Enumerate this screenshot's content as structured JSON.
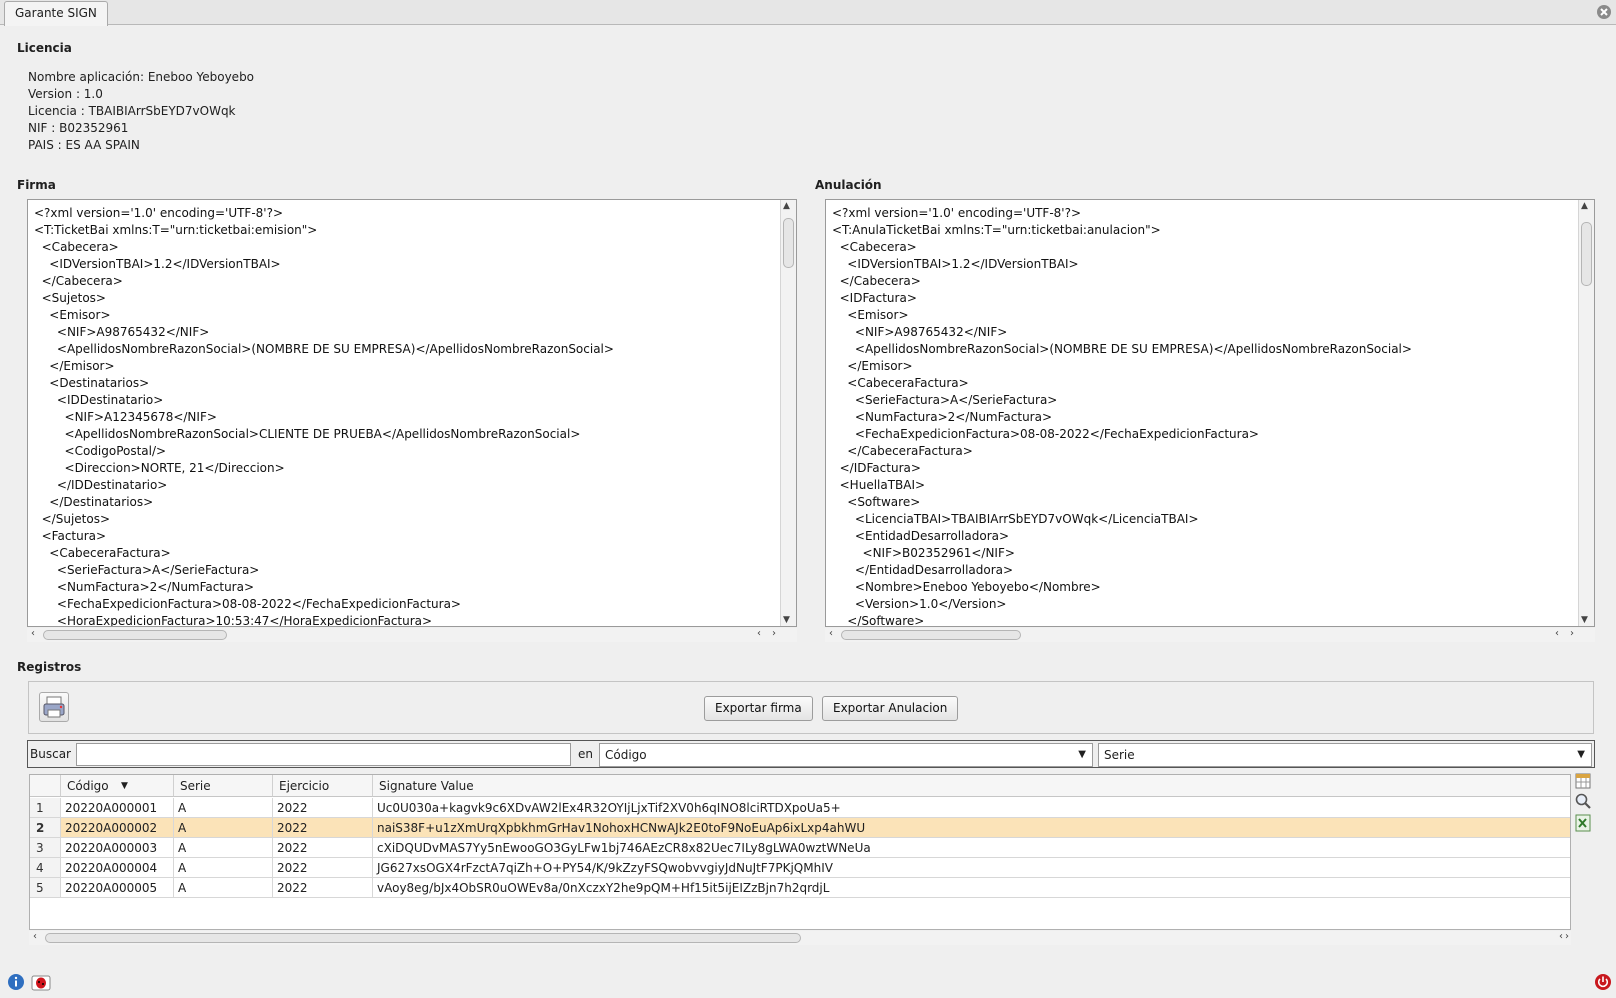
{
  "window": {
    "tab_title": "Garante SIGN"
  },
  "licencia": {
    "title": "Licencia",
    "lines": [
      "Nombre aplicación: Eneboo Yeboyebo",
      "Version : 1.0",
      "Licencia : TBAIBIArrSbEYD7vOWqk",
      "NIF : B02352961",
      "PAIS : ES AA SPAIN"
    ]
  },
  "firma": {
    "title": "Firma",
    "lines": [
      "<?xml version='1.0' encoding='UTF-8'?>",
      "<T:TicketBai xmlns:T=\"urn:ticketbai:emision\">",
      "  <Cabecera>",
      "    <IDVersionTBAI>1.2</IDVersionTBAI>",
      "  </Cabecera>",
      "  <Sujetos>",
      "    <Emisor>",
      "      <NIF>A98765432</NIF>",
      "      <ApellidosNombreRazonSocial>(NOMBRE DE SU EMPRESA)</ApellidosNombreRazonSocial>",
      "    </Emisor>",
      "    <Destinatarios>",
      "      <IDDestinatario>",
      "        <NIF>A12345678</NIF>",
      "        <ApellidosNombreRazonSocial>CLIENTE DE PRUEBA</ApellidosNombreRazonSocial>",
      "        <CodigoPostal/>",
      "        <Direccion>NORTE, 21</Direccion>",
      "      </IDDestinatario>",
      "    </Destinatarios>",
      "  </Sujetos>",
      "  <Factura>",
      "    <CabeceraFactura>",
      "      <SerieFactura>A</SerieFactura>",
      "      <NumFactura>2</NumFactura>",
      "      <FechaExpedicionFactura>08-08-2022</FechaExpedicionFactura>",
      "      <HoraExpedicionFactura>10:53:47</HoraExpedicionFactura>"
    ]
  },
  "anulacion": {
    "title": "Anulación",
    "lines": [
      "<?xml version='1.0' encoding='UTF-8'?>",
      "<T:AnulaTicketBai xmlns:T=\"urn:ticketbai:anulacion\">",
      "  <Cabecera>",
      "    <IDVersionTBAI>1.2</IDVersionTBAI>",
      "  </Cabecera>",
      "  <IDFactura>",
      "    <Emisor>",
      "      <NIF>A98765432</NIF>",
      "      <ApellidosNombreRazonSocial>(NOMBRE DE SU EMPRESA)</ApellidosNombreRazonSocial>",
      "    </Emisor>",
      "    <CabeceraFactura>",
      "      <SerieFactura>A</SerieFactura>",
      "      <NumFactura>2</NumFactura>",
      "      <FechaExpedicionFactura>08-08-2022</FechaExpedicionFactura>",
      "    </CabeceraFactura>",
      "  </IDFactura>",
      "  <HuellaTBAI>",
      "    <Software>",
      "      <LicenciaTBAI>TBAIBIArrSbEYD7vOWqk</LicenciaTBAI>",
      "      <EntidadDesarrolladora>",
      "        <NIF>B02352961</NIF>",
      "      </EntidadDesarrolladora>",
      "      <Nombre>Eneboo Yeboyebo</Nombre>",
      "      <Version>1.0</Version>",
      "    </Software>"
    ]
  },
  "registros": {
    "title": "Registros",
    "export_firma": "Exportar firma",
    "export_anulacion": "Exportar Anulacion",
    "search_label": "Buscar",
    "search_value": "",
    "en_label": "en",
    "field_select": "Código",
    "second_select": "Serie",
    "columns": [
      "Código",
      "Serie",
      "Ejercicio",
      "Signature Value"
    ],
    "rows": [
      {
        "n": "1",
        "codigo": "20220A000001",
        "serie": "A",
        "ejercicio": "2022",
        "sig": "Uc0U030a+kagvk9c6XDvAW2lEx4R32OYIjLjxTif2XV0h6qINO8lciRTDXpoUa5+"
      },
      {
        "n": "2",
        "codigo": "20220A000002",
        "serie": "A",
        "ejercicio": "2022",
        "sig": "naiS38F+u1zXmUrqXpbkhmGrHav1NohoxHCNwAJk2E0toF9NoEuAp6ixLxp4ahWU"
      },
      {
        "n": "3",
        "codigo": "20220A000003",
        "serie": "A",
        "ejercicio": "2022",
        "sig": "cXiDQUDvMAS7Yy5nEwooGO3GyLFw1bj746AEzCR8x82Uec7ILy8gLWA0wztWNeUa"
      },
      {
        "n": "4",
        "codigo": "20220A000004",
        "serie": "A",
        "ejercicio": "2022",
        "sig": "JG627xsOGX4rFzctA7qiZh+O+PY54/K/9kZzyFSQwobvvgiyJdNuJtF7PKjQMhIV"
      },
      {
        "n": "5",
        "codigo": "20220A000005",
        "serie": "A",
        "ejercicio": "2022",
        "sig": "vAoy8eg/bJx4ObSR0uOWEv8a/0nXczxY2he9pQM+Hf15it5ijEIZzBjn7h2qrdjL"
      }
    ],
    "selected_row": 2
  }
}
